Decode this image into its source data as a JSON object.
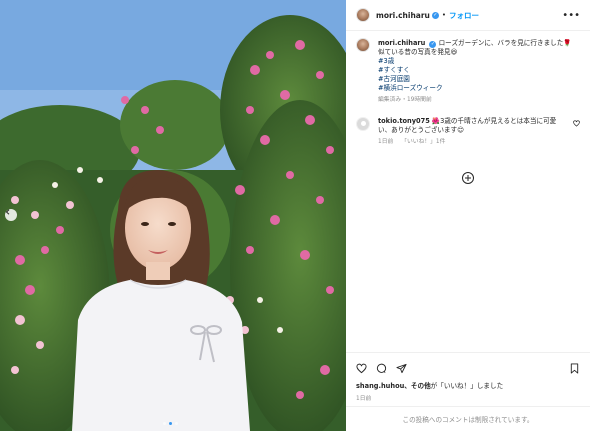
{
  "post": {
    "username": "mori.chiharu",
    "follow_label": "フォロー",
    "separator": "•",
    "more_icon": "more-horizontal-icon",
    "verified_icon": "verified-badge-icon",
    "accent": "#0095f6"
  },
  "caption": {
    "username": "mori.chiharu",
    "line1": "ローズガーデンに、バラを見に行きました🌹",
    "line2": "似ている昔の写真を発見😆",
    "hashtags": [
      "#3歳",
      "#すくすく",
      "#古河庭園",
      "#横浜ローズウィーク"
    ],
    "meta": "編集済み・19時間前"
  },
  "comment": {
    "username": "tokio.tony075",
    "text": "🌺3歳の千晴さんが見えるとは本当に可愛い、ありがとうございます😊",
    "time": "1日前",
    "likes": "「いいね！」1件"
  },
  "actions": {
    "like_icon": "heart-icon",
    "comment_icon": "comment-icon",
    "share_icon": "send-icon",
    "save_icon": "bookmark-icon"
  },
  "likes_summary": {
    "user": "shang.huhou",
    "rest": "、その他",
    "suffix": "が「いいね！」しました"
  },
  "post_date": "1日前",
  "comments_limited": "この投稿へのコメントは制限されています。",
  "carousel": {
    "current_index": 2,
    "total": 3
  }
}
